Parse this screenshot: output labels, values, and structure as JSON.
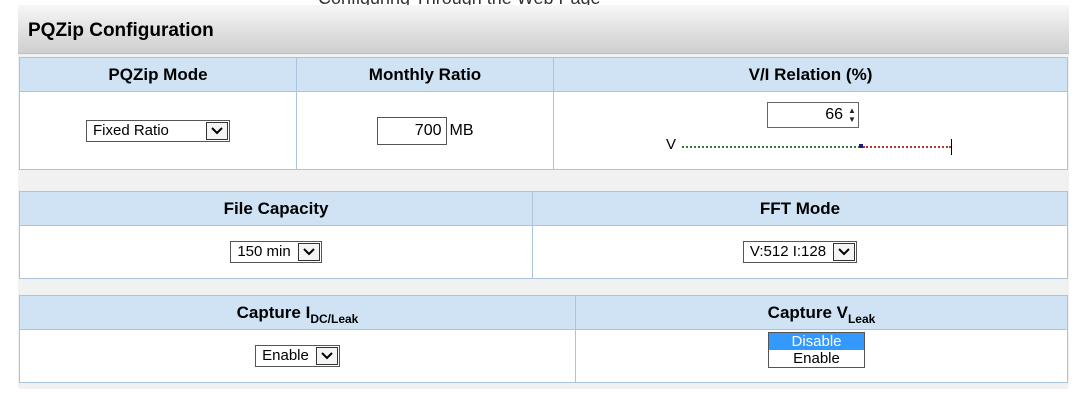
{
  "top_clipped_text": "Configuring Through the Web Page",
  "panel": {
    "title": "PQZip Configuration"
  },
  "row1": {
    "headers": [
      "PQZip Mode",
      "Monthly Ratio",
      "V/I Relation (%)"
    ],
    "pqzip_mode": {
      "selected": "Fixed Ratio"
    },
    "monthly_ratio": {
      "value": "700",
      "unit": "MB"
    },
    "vi_relation": {
      "value": "66",
      "slider_left_label": "V",
      "slider_right_label": "I",
      "slider_percent": 66,
      "slider_left_color": "#2f7d2f",
      "slider_right_color": "#b03a2e"
    }
  },
  "row2": {
    "headers": [
      "File Capacity",
      "FFT Mode"
    ],
    "file_capacity": {
      "selected": "150 min"
    },
    "fft_mode": {
      "selected": "V:512 I:128"
    }
  },
  "row3": {
    "capture_i": {
      "label": "Capture I",
      "subscript": "DC/Leak",
      "selected": "Enable"
    },
    "capture_v": {
      "label": "Capture V",
      "subscript": "Leak",
      "options": [
        "Disable",
        "Enable"
      ],
      "highlighted": "Disable"
    }
  },
  "colors": {
    "header_bg": "#cfe3f5",
    "border": "#a9c4dc",
    "highlight": "#3399ff"
  }
}
